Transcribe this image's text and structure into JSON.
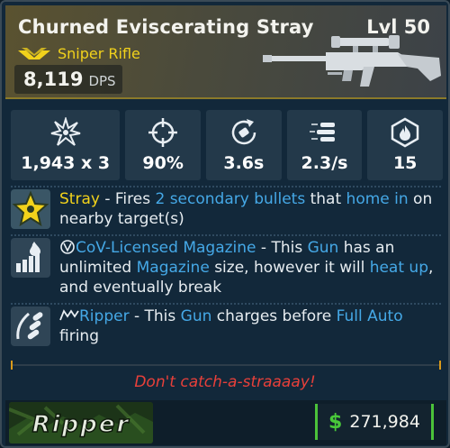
{
  "item": {
    "name": "Churned Eviscerating Stray",
    "level": "Lvl 50",
    "type": "Sniper Rifle",
    "dps_value": "8,119",
    "dps_unit": "DPS"
  },
  "stats": [
    {
      "icon": "damage-burst-icon",
      "value": "1,943 x 3"
    },
    {
      "icon": "crosshair-accuracy-icon",
      "value": "90%"
    },
    {
      "icon": "reload-time-icon",
      "value": "3.6s"
    },
    {
      "icon": "fire-rate-icon",
      "value": "2.3/s"
    },
    {
      "icon": "magazine-flame-icon",
      "value": "15"
    }
  ],
  "perks": {
    "stray": {
      "name": "Stray",
      "t1": " - Fires ",
      "h1": "2 secondary bullets",
      "t2": " that ",
      "h2": "home in",
      "t3": " on nearby target(s)"
    },
    "cov": {
      "name": "CoV-Licensed Magazine",
      "t1": " - This ",
      "h1": "Gun",
      "t2": " has an unlimited ",
      "h2": "Magazine",
      "t3": " size, however it will ",
      "h3": "heat up",
      "t4": ", and eventually break"
    },
    "ripper": {
      "name": "Ripper",
      "t1": " - This ",
      "h1": "Gun",
      "t2": " charges before ",
      "h2": "Full Auto",
      "t3": " firing"
    }
  },
  "flavor_text": "Don't catch-a-straaaay!",
  "manufacturer": "Ripper",
  "price": {
    "symbol": "$",
    "value": "271,984"
  },
  "colors": {
    "rarity": "#f2d21b",
    "keyword": "#45a8e6",
    "flavor": "#e8403a",
    "currency": "#49c93a"
  }
}
